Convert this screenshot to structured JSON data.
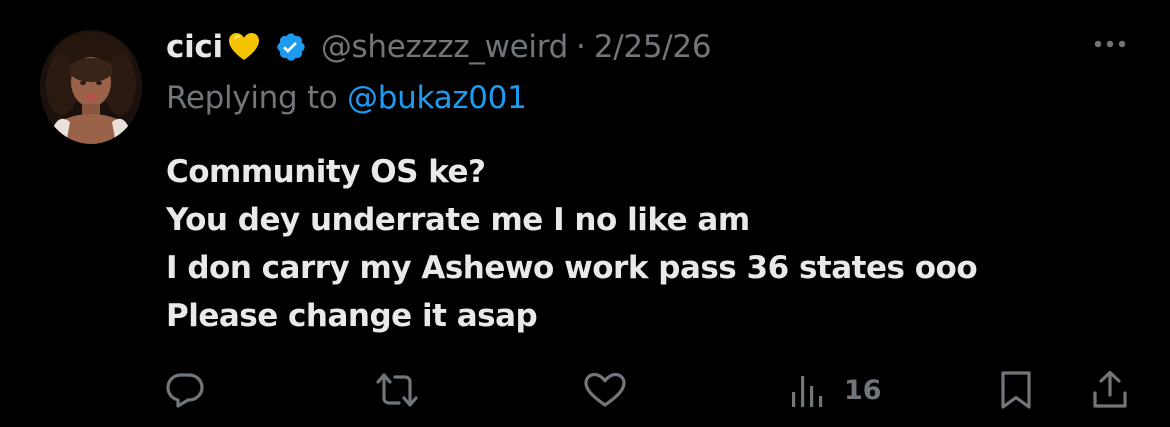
{
  "author": {
    "name": "cici",
    "name_emoji": "yellow-heart",
    "verified": true,
    "handle": "@shezzzz_weird",
    "separator": "·",
    "date": "2/25/26"
  },
  "reply": {
    "prefix": "Replying to",
    "mention": "@bukaz001"
  },
  "body": {
    "lines": [
      "Community OS ke?",
      "You dey underrate me I no like am",
      "I don carry my Ashewo work pass 36 states ooo",
      "Please change it asap"
    ]
  },
  "actions": {
    "views_count": "16"
  },
  "colors": {
    "background": "#000000",
    "text_primary": "#e7e9ea",
    "text_secondary": "#71767b",
    "accent": "#1d9bf0",
    "heart_emoji": "#f5c400"
  },
  "icons": {
    "more": "more-dots-icon",
    "reply": "reply-bubble-icon",
    "retweet": "retweet-icon",
    "like": "heart-outline-icon",
    "views": "views-bars-icon",
    "bookmark": "bookmark-icon",
    "share": "share-icon"
  }
}
